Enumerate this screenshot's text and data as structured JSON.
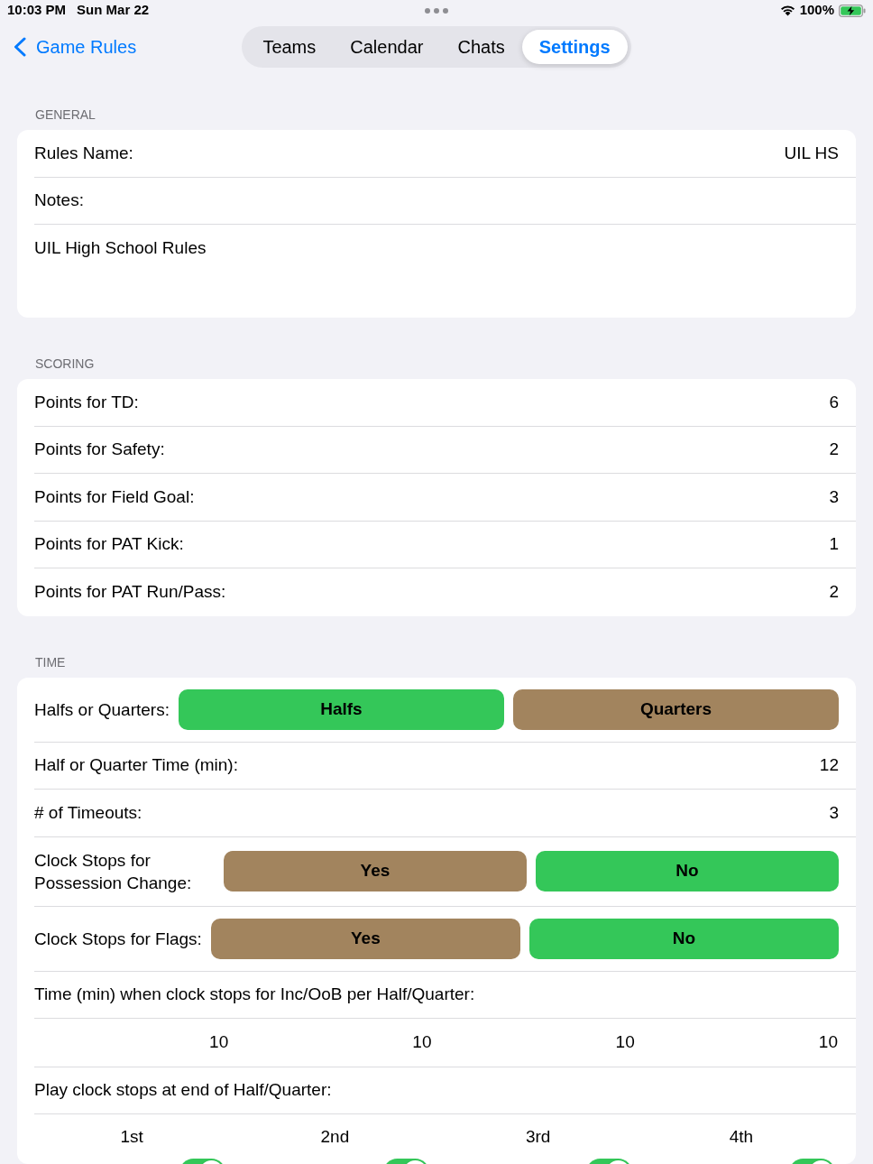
{
  "status_bar": {
    "time": "10:03 PM",
    "date": "Sun Mar 22",
    "battery": "100%"
  },
  "nav": {
    "back": "Game Rules",
    "tabs": [
      {
        "label": "Teams",
        "selected": false
      },
      {
        "label": "Calendar",
        "selected": false
      },
      {
        "label": "Chats",
        "selected": false
      },
      {
        "label": "Settings",
        "selected": true
      }
    ]
  },
  "sections": [
    {
      "header": "GENERAL",
      "rows": [
        {
          "kind": "value",
          "label": "Rules Name:",
          "value": "UIL HS"
        },
        {
          "kind": "label",
          "label": "Notes:"
        },
        {
          "kind": "note",
          "text": "UIL High School Rules"
        }
      ]
    },
    {
      "header": "SCORING",
      "rows": [
        {
          "kind": "value",
          "label": "Points for TD:",
          "value": "6"
        },
        {
          "kind": "value",
          "label": "Points for Safety:",
          "value": "2"
        },
        {
          "kind": "value",
          "label": "Points for Field Goal:",
          "value": "3"
        },
        {
          "kind": "value",
          "label": "Points for PAT Kick:",
          "value": "1"
        },
        {
          "kind": "value",
          "label": "Points for PAT Run/Pass:",
          "value": "2"
        }
      ]
    },
    {
      "header": "TIME",
      "rows": [
        {
          "kind": "choice",
          "label": "Halfs or Quarters:",
          "options": [
            {
              "label": "Halfs",
              "selected": true
            },
            {
              "label": "Quarters",
              "selected": false
            }
          ]
        },
        {
          "kind": "value",
          "label": "Half or Quarter Time (min):",
          "value": "12"
        },
        {
          "kind": "value",
          "label": "# of Timeouts:",
          "value": "3"
        },
        {
          "kind": "choice",
          "label": "Clock Stops for Possession Change:",
          "options": [
            {
              "label": "Yes",
              "selected": false
            },
            {
              "label": "No",
              "selected": true
            }
          ]
        },
        {
          "kind": "choice",
          "label": "Clock Stops for Flags:",
          "options": [
            {
              "label": "Yes",
              "selected": false
            },
            {
              "label": "No",
              "selected": true
            }
          ]
        },
        {
          "kind": "label",
          "label": "Time (min) when clock stops for Inc/OoB per Half/Quarter:"
        },
        {
          "kind": "numbers",
          "values": [
            "10",
            "10",
            "10",
            "10"
          ]
        },
        {
          "kind": "label",
          "label": "Play clock stops at end of Half/Quarter:"
        },
        {
          "kind": "toggles",
          "items": [
            {
              "label": "1st",
              "on": true
            },
            {
              "label": "2nd",
              "on": true
            },
            {
              "label": "3rd",
              "on": true
            },
            {
              "label": "4th",
              "on": true
            }
          ]
        }
      ]
    }
  ]
}
